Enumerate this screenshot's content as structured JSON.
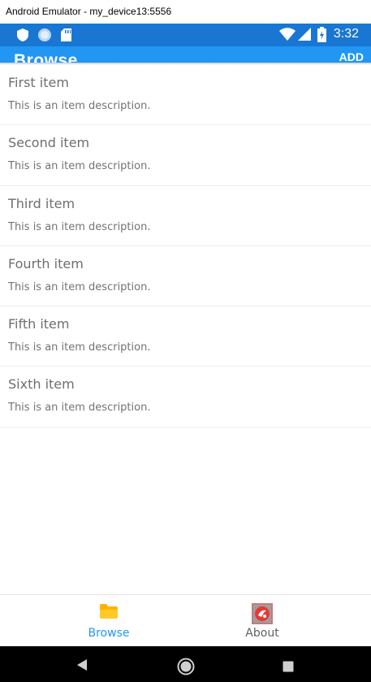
{
  "window": {
    "title": "Android Emulator - my_device13:5556"
  },
  "status_bar": {
    "time": "3:32"
  },
  "app_bar": {
    "title": "Browse",
    "add_label": "ADD"
  },
  "items": [
    {
      "name": "First item",
      "description": "This is an item description."
    },
    {
      "name": "Second item",
      "description": "This is an item description."
    },
    {
      "name": "Third item",
      "description": "This is an item description."
    },
    {
      "name": "Fourth item",
      "description": "This is an item description."
    },
    {
      "name": "Fifth item",
      "description": "This is an item description."
    },
    {
      "name": "Sixth item",
      "description": "This is an item description."
    }
  ],
  "tabs": [
    {
      "label": "Browse",
      "icon": "folder-icon",
      "active": true,
      "color": "#2196f3"
    },
    {
      "label": "About",
      "icon": "about-icon",
      "active": false,
      "color": "#616161"
    }
  ],
  "colors": {
    "status_bar": "#1976d2",
    "app_bar": "#2196f3",
    "folder_icon": "#ffc107"
  }
}
